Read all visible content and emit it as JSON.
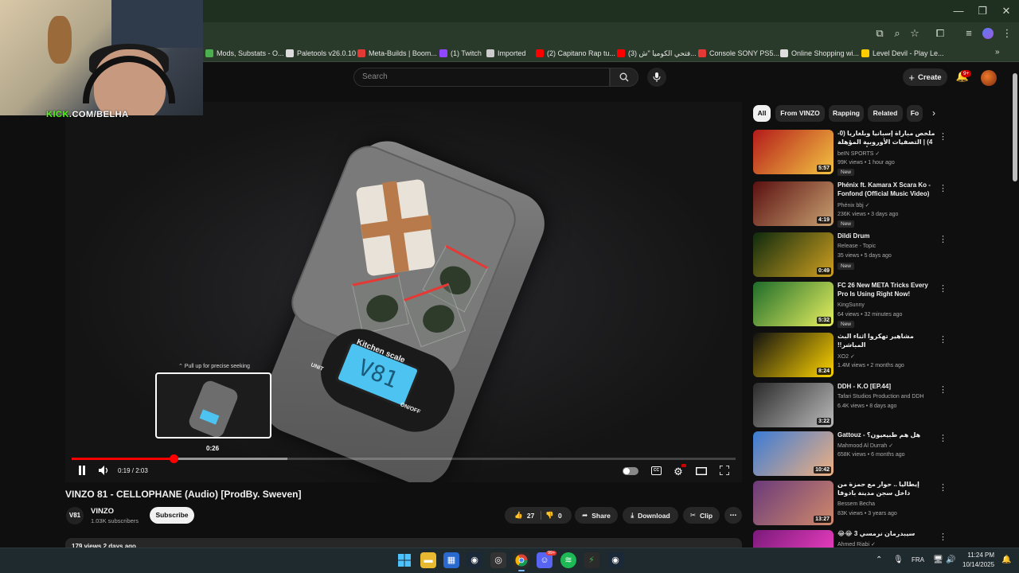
{
  "browser": {
    "bookmarks": [
      {
        "label": "Mods, Substats - O...",
        "color": "#4caf50"
      },
      {
        "label": "Paletools v26.0.10",
        "color": "#dddddd"
      },
      {
        "label": "Meta-Builds | Boom...",
        "color": "#e53935"
      },
      {
        "label": "(1) Twitch",
        "color": "#9146ff"
      },
      {
        "label": "Imported",
        "color": "#cccccc"
      },
      {
        "label": "(2) Capitano Rap tu...",
        "color": "#ff0000"
      },
      {
        "label": "(3) فتحي الكوميا \"ش...",
        "color": "#ff0000"
      },
      {
        "label": "Console SONY PS5...",
        "color": "#e53935"
      },
      {
        "label": "Online Shopping wi...",
        "color": "#dddddd"
      },
      {
        "label": "Level Devil - Play Le...",
        "color": "#ffcc00"
      }
    ]
  },
  "webcam": {
    "label_prefix": "KICK",
    "label_suffix": ".COM/BELHA"
  },
  "header": {
    "search_placeholder": "Search",
    "create_label": "Create",
    "notification_count": "9+"
  },
  "player": {
    "seek_tip": "⌃ Pull up for precise seeking",
    "preview_time": "0:26",
    "time_display": "0:19 / 2:03",
    "played_fraction": 0.154,
    "buffered_fraction": 0.325,
    "lcd_text": "V81",
    "scale_label": "Kitchen scale",
    "unit_label": "UNIT",
    "onoff_label": "ON/OFF"
  },
  "video": {
    "title": "VINZO 81 - CELLOPHANE (Audio) [ProdBy. Sweven]",
    "channel_avatar": "V81",
    "channel_name": "VINZO",
    "subscribers": "1.03K subscribers",
    "subscribe_label": "Subscribe",
    "likes": "27",
    "dislikes": "0",
    "share_label": "Share",
    "download_label": "Download",
    "clip_label": "Clip",
    "description_line": "179 views  2 days ago"
  },
  "chips": [
    "All",
    "From VINZO",
    "Rapping",
    "Related",
    "Fo"
  ],
  "recommendations": [
    {
      "title": "ملخص مباراة إسبانيا وبلغاريا (0-4) | التصفيات الأوروبية المؤهلة إلى كأس العالم",
      "rtl": true,
      "channel": "beIN SPORTS ✓",
      "views": "99K views • 1 hour ago",
      "duration": "5:57",
      "new": "New",
      "color1": "#b31b1b",
      "color2": "#f4c542"
    },
    {
      "title": "Phénix ft. Kamara X Scara Ko - Fonfond (Official Music Video)",
      "rtl": false,
      "channel": "Phénix bbj ✓",
      "views": "236K views • 3 days ago",
      "duration": "4:19",
      "new": "New",
      "color1": "#5a1010",
      "color2": "#c8a070"
    },
    {
      "title": "Dildi Drum",
      "rtl": false,
      "channel": "Release - Topic",
      "views": "35 views • 5 days ago",
      "duration": "0:49",
      "new": "New",
      "color1": "#0e2a0e",
      "color2": "#d0a020"
    },
    {
      "title": "FC 26 New META Tricks Every Pro Is Using Right Now!",
      "rtl": false,
      "channel": "KingSunny",
      "views": "64 views • 32 minutes ago",
      "duration": "5:32",
      "new": "New",
      "color1": "#1d6b2a",
      "color2": "#e8f060"
    },
    {
      "title": "مشاهير تهكروا اثناء البث المباشر!!",
      "rtl": true,
      "channel": "XO2 ✓",
      "views": "1.4M views • 2 months ago",
      "duration": "8:24",
      "new": "",
      "color1": "#111111",
      "color2": "#ffd400"
    },
    {
      "title": "DDH - K.O [EP.44]",
      "rtl": false,
      "channel": "Tafari Studios Production and DDH",
      "views": "6.4K views • 8 days ago",
      "duration": "3:22",
      "new": "",
      "color1": "#2a2a2a",
      "color2": "#bbbbbb"
    },
    {
      "title": "Gattouz - هل هم طبيعيون؟",
      "rtl": false,
      "channel": "Mahmood Al Durrah ✓",
      "views": "658K views • 6 months ago",
      "duration": "10:42",
      "new": "",
      "color1": "#3a7bd5",
      "color2": "#f0b080"
    },
    {
      "title": "إيطاليا .. حوار مع حمزة من داخل سجن مدينة بادوفا الإيطالية في الحبس على زوج و...",
      "rtl": true,
      "channel": "Bessem Becha",
      "views": "83K views • 3 years ago",
      "duration": "13:27",
      "new": "",
      "color1": "#6a3a7a",
      "color2": "#d08a6a"
    },
    {
      "title": "سيبدرمان نرمسي 3 😂😂",
      "rtl": true,
      "channel": "Ahmed Riabi ✓",
      "views": "",
      "duration": "",
      "new": "",
      "color1": "#7a1a7a",
      "color2": "#ff44cc"
    }
  ],
  "taskbar": {
    "lang": "FRA",
    "time": "11:24 PM",
    "date": "10/14/2025",
    "discord_badge": "99+"
  }
}
